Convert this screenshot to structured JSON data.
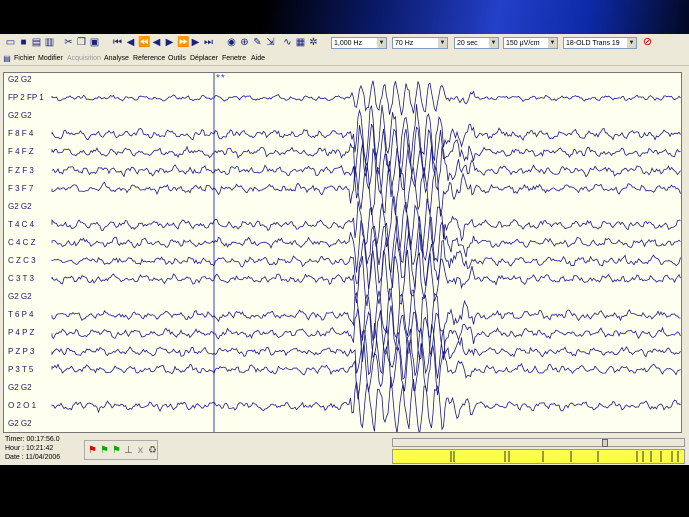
{
  "toolbar": {
    "sampling_rate": "1,000 Hz",
    "filter": "70 Hz",
    "time_window": "20 sec",
    "sensitivity": "150 µV/cm",
    "montage": "18-OLD Trans 19"
  },
  "menu": {
    "fichier": "Fichier",
    "modifier": "Modifier",
    "acquisition": "Acquisition",
    "analyse": "Analyse",
    "reference": "Reference",
    "outils": "Outils",
    "deplacer": "Déplacer",
    "fenetre": "Fenetre",
    "aide": "Aide"
  },
  "marker_text": "**",
  "channels": [
    {
      "label": "G2 G2"
    },
    {
      "label": "FP 2 FP 1"
    },
    {
      "label": "G2 G2"
    },
    {
      "label": "F 8 F 4"
    },
    {
      "label": "F 4 F Z"
    },
    {
      "label": "F Z F 3"
    },
    {
      "label": "F 3 F 7"
    },
    {
      "label": "G2 G2"
    },
    {
      "label": "T 4 C 4"
    },
    {
      "label": "C 4 C Z"
    },
    {
      "label": "C Z C 3"
    },
    {
      "label": "C 3 T 3"
    },
    {
      "label": "G2 G2"
    },
    {
      "label": "T 6 P 4"
    },
    {
      "label": "P 4 P Z"
    },
    {
      "label": "P Z P 3"
    },
    {
      "label": "P 3 T 5"
    },
    {
      "label": "G2 G2"
    },
    {
      "label": "O 2 O 1"
    },
    {
      "label": "G2 G2"
    }
  ],
  "status": {
    "timer": "Timer: 00:17:56.0",
    "hour": "Hour  : 10:21:42",
    "date": "Date  : 11/04/2006"
  },
  "colors": {
    "trace": "#1a1a8a",
    "plot_bg": "#fffff0",
    "ruler": "#ffff4a"
  }
}
